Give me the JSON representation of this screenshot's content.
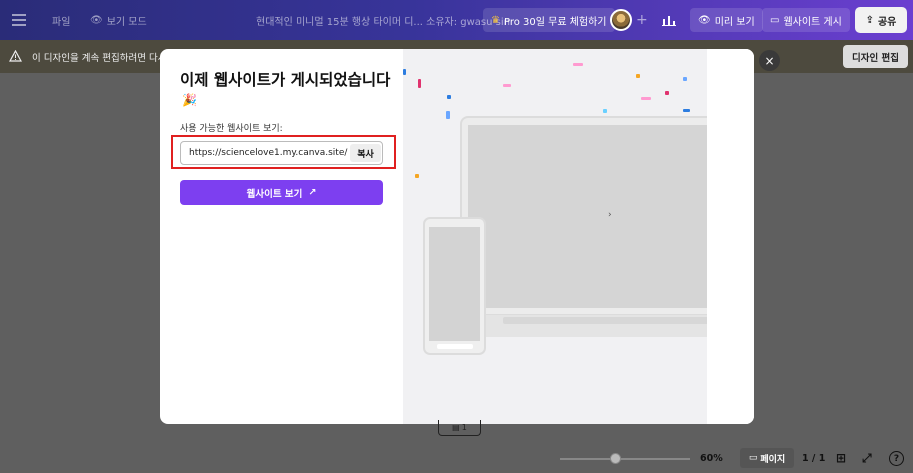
{
  "topbar": {
    "file_label": "파일",
    "view_mode_label": "보기 모드",
    "doc_title": "현대적인 미니멀 15분 행상 타이머 디... 소유자: gwasu sin",
    "pro_trial_label": "Pro 30일 무료 체험하기",
    "plus": "+",
    "preview_label": "미리 보기",
    "publish_label": "웹사이트 게시",
    "share_label": "공유"
  },
  "warning": {
    "text": "이 디자인을 계속 편집하려면 다시 ...",
    "edit_design_label": "디자인 편집"
  },
  "modal": {
    "title": "이제 웹사이트가 게시되었습니다",
    "emoji": "🎉",
    "url_label": "사용 가능한 웹사이트 보기:",
    "url": "https://sciencelove1.my.canva.site/",
    "copy_label": "복사",
    "view_site_label": "웹사이트 보기",
    "view_site_arrow": "↗",
    "close": "×"
  },
  "bottom": {
    "page_number": "1",
    "zoom": "60%",
    "pages_label": "페이지",
    "page_count": "1 / 1",
    "help": "?"
  },
  "colors": {
    "accent": "#7d3ff0",
    "highlight": "#e02020"
  }
}
